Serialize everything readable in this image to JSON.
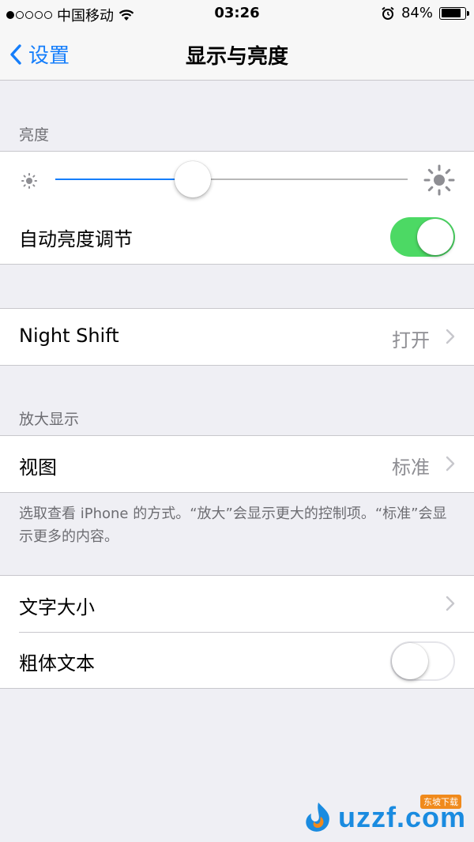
{
  "status_bar": {
    "carrier": "中国移动",
    "time": "03:26",
    "battery": "84%",
    "battery_level": 0.84,
    "signal_bars_filled": 1,
    "signal_bars_total": 5
  },
  "nav": {
    "back_label": "设置",
    "title": "显示与亮度"
  },
  "brightness_section": {
    "header": "亮度",
    "slider_level": 0.39,
    "auto_label": "自动亮度调节",
    "auto_on": true
  },
  "night_shift": {
    "label": "Night Shift",
    "value": "打开"
  },
  "zoom_section": {
    "header": "放大显示",
    "view_label": "视图",
    "view_value": "标准",
    "footer": "选取查看 iPhone 的方式。“放大”会显示更大的控制项。“标准”会显示更多的内容。"
  },
  "text_section": {
    "text_size_label": "文字大小",
    "bold_label": "粗体文本",
    "bold_on": false
  },
  "watermark": {
    "text": "uzzf.com",
    "sub": "东坡下载"
  },
  "colors": {
    "accent": "#157efb",
    "toggle_on": "#4cd964",
    "background": "#efeff4"
  }
}
